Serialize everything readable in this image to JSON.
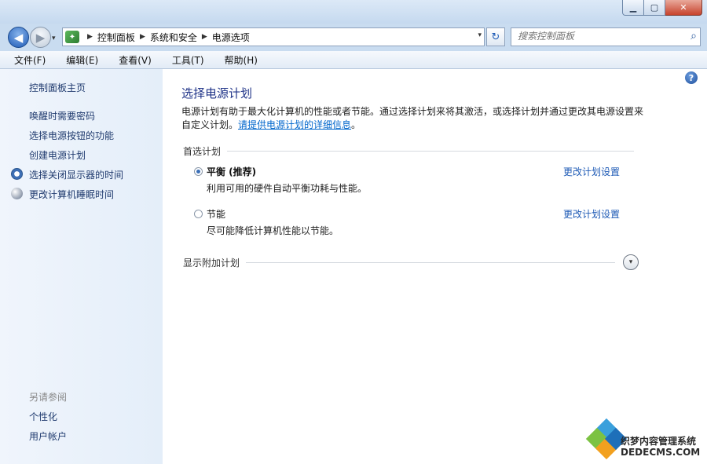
{
  "window": {
    "buttons": {
      "minimize": "▁",
      "maximize": "▢",
      "close": "✕"
    }
  },
  "nav": {
    "back": "◀",
    "forward": "▶",
    "dropdown": "▾",
    "breadcrumb": [
      "控制面板",
      "系统和安全",
      "电源选项"
    ],
    "refresh": "↻",
    "search_placeholder": "搜索控制面板",
    "search_icon": "⌕"
  },
  "menu": [
    "文件(F)",
    "编辑(E)",
    "查看(V)",
    "工具(T)",
    "帮助(H)"
  ],
  "sidebar": {
    "home": "控制面板主页",
    "links": [
      "唤醒时需要密码",
      "选择电源按钮的功能",
      "创建电源计划",
      "选择关闭显示器的时间",
      "更改计算机睡眠时间"
    ],
    "see_also_title": "另请参阅",
    "see_also": [
      "个性化",
      "用户帐户"
    ]
  },
  "main": {
    "help": "?",
    "title": "选择电源计划",
    "desc": "电源计划有助于最大化计算机的性能或者节能。通过选择计划来将其激活，或选择计划并通过更改其电源设置来自定义计划。",
    "desc_link": "请提供电源计划的详细信息",
    "desc_end": "。",
    "group_title": "首选计划",
    "plans": [
      {
        "name": "平衡 (推荐)",
        "desc": "利用可用的硬件自动平衡功耗与性能。",
        "selected": true,
        "change": "更改计划设置"
      },
      {
        "name": "节能",
        "desc": "尽可能降低计算机性能以节能。",
        "selected": false,
        "change": "更改计划设置"
      }
    ],
    "more_plans": "显示附加计划",
    "expand_icon": "▾"
  },
  "watermark": {
    "line1": "织梦内容管理系统",
    "line2": "DEDECMS.COM"
  }
}
